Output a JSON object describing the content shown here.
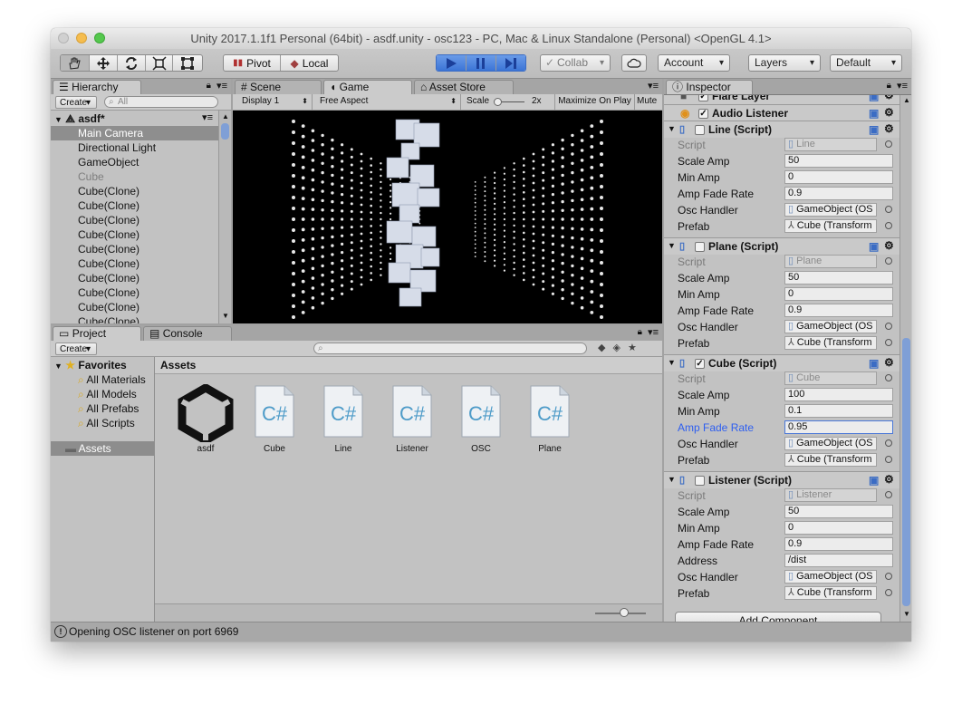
{
  "window": {
    "title": "Unity 2017.1.1f1 Personal (64bit) - asdf.unity - osc123 - PC, Mac & Linux Standalone (Personal) <OpenGL 4.1>"
  },
  "toolbar": {
    "pivot_label": "Pivot",
    "local_label": "Local",
    "collab_label": "Collab",
    "account_label": "Account",
    "layers_label": "Layers",
    "layout_label": "Default"
  },
  "hierarchy": {
    "tab_label": "Hierarchy",
    "create_label": "Create",
    "search_placeholder": "All",
    "scene_name": "asdf*",
    "items": [
      {
        "label": "Main Camera",
        "selected": true
      },
      {
        "label": "Directional Light"
      },
      {
        "label": "GameObject"
      },
      {
        "label": "Cube",
        "dim": true
      },
      {
        "label": "Cube(Clone)"
      },
      {
        "label": "Cube(Clone)"
      },
      {
        "label": "Cube(Clone)"
      },
      {
        "label": "Cube(Clone)"
      },
      {
        "label": "Cube(Clone)"
      },
      {
        "label": "Cube(Clone)"
      },
      {
        "label": "Cube(Clone)"
      },
      {
        "label": "Cube(Clone)"
      },
      {
        "label": "Cube(Clone)"
      },
      {
        "label": "Cube(Clone)"
      }
    ]
  },
  "game_view": {
    "tabs": [
      "Scene",
      "Game",
      "Asset Store"
    ],
    "display": "Display 1",
    "aspect": "Free Aspect",
    "scale_label": "Scale",
    "scale_value": "2x",
    "maximize_label": "Maximize On Play",
    "mute_label": "Mute"
  },
  "project": {
    "tabs": [
      "Project",
      "Console"
    ],
    "create_label": "Create",
    "favorites_label": "Favorites",
    "favorites": [
      "All Materials",
      "All Models",
      "All Prefabs",
      "All Scripts"
    ],
    "assets_folder": "Assets",
    "breadcrumb": "Assets",
    "assets": [
      {
        "name": "asdf",
        "type": "unity"
      },
      {
        "name": "Cube",
        "type": "cs"
      },
      {
        "name": "Line",
        "type": "cs"
      },
      {
        "name": "Listener",
        "type": "cs"
      },
      {
        "name": "OSC",
        "type": "cs"
      },
      {
        "name": "Plane",
        "type": "cs"
      }
    ]
  },
  "inspector": {
    "tab_label": "Inspector",
    "top_components": [
      "Flare Layer",
      "Audio Listener"
    ],
    "components": [
      {
        "title": "Line (Script)",
        "enabled": false,
        "fields": [
          {
            "label": "Script",
            "value": "Line",
            "kind": "ro"
          },
          {
            "label": "Scale Amp",
            "value": "50"
          },
          {
            "label": "Min Amp",
            "value": "0"
          },
          {
            "label": "Amp Fade Rate",
            "value": "0.9"
          },
          {
            "label": "Osc Handler",
            "value": "GameObject (OS",
            "kind": "ref"
          },
          {
            "label": "Prefab",
            "value": "Cube (Transform",
            "kind": "ref"
          }
        ]
      },
      {
        "title": "Plane (Script)",
        "enabled": false,
        "fields": [
          {
            "label": "Script",
            "value": "Plane",
            "kind": "ro"
          },
          {
            "label": "Scale Amp",
            "value": "50"
          },
          {
            "label": "Min Amp",
            "value": "0"
          },
          {
            "label": "Amp Fade Rate",
            "value": "0.9"
          },
          {
            "label": "Osc Handler",
            "value": "GameObject (OS",
            "kind": "ref"
          },
          {
            "label": "Prefab",
            "value": "Cube (Transform",
            "kind": "ref"
          }
        ]
      },
      {
        "title": "Cube (Script)",
        "enabled": true,
        "fields": [
          {
            "label": "Script",
            "value": "Cube",
            "kind": "ro"
          },
          {
            "label": "Scale Amp",
            "value": "100"
          },
          {
            "label": "Min Amp",
            "value": "0.1"
          },
          {
            "label": "Amp Fade Rate",
            "value": "0.95",
            "kind": "focus"
          },
          {
            "label": "Osc Handler",
            "value": "GameObject (OS",
            "kind": "ref"
          },
          {
            "label": "Prefab",
            "value": "Cube (Transform",
            "kind": "ref"
          }
        ]
      },
      {
        "title": "Listener (Script)",
        "enabled": false,
        "fields": [
          {
            "label": "Script",
            "value": "Listener",
            "kind": "ro"
          },
          {
            "label": "Scale Amp",
            "value": "50"
          },
          {
            "label": "Min Amp",
            "value": "0"
          },
          {
            "label": "Amp Fade Rate",
            "value": "0.9"
          },
          {
            "label": "Address",
            "value": "/dist"
          },
          {
            "label": "Osc Handler",
            "value": "GameObject (OS",
            "kind": "ref"
          },
          {
            "label": "Prefab",
            "value": "Cube (Transform",
            "kind": "ref"
          }
        ]
      }
    ],
    "add_component_label": "Add Component"
  },
  "status": {
    "message": "Opening OSC listener on port 6969"
  }
}
